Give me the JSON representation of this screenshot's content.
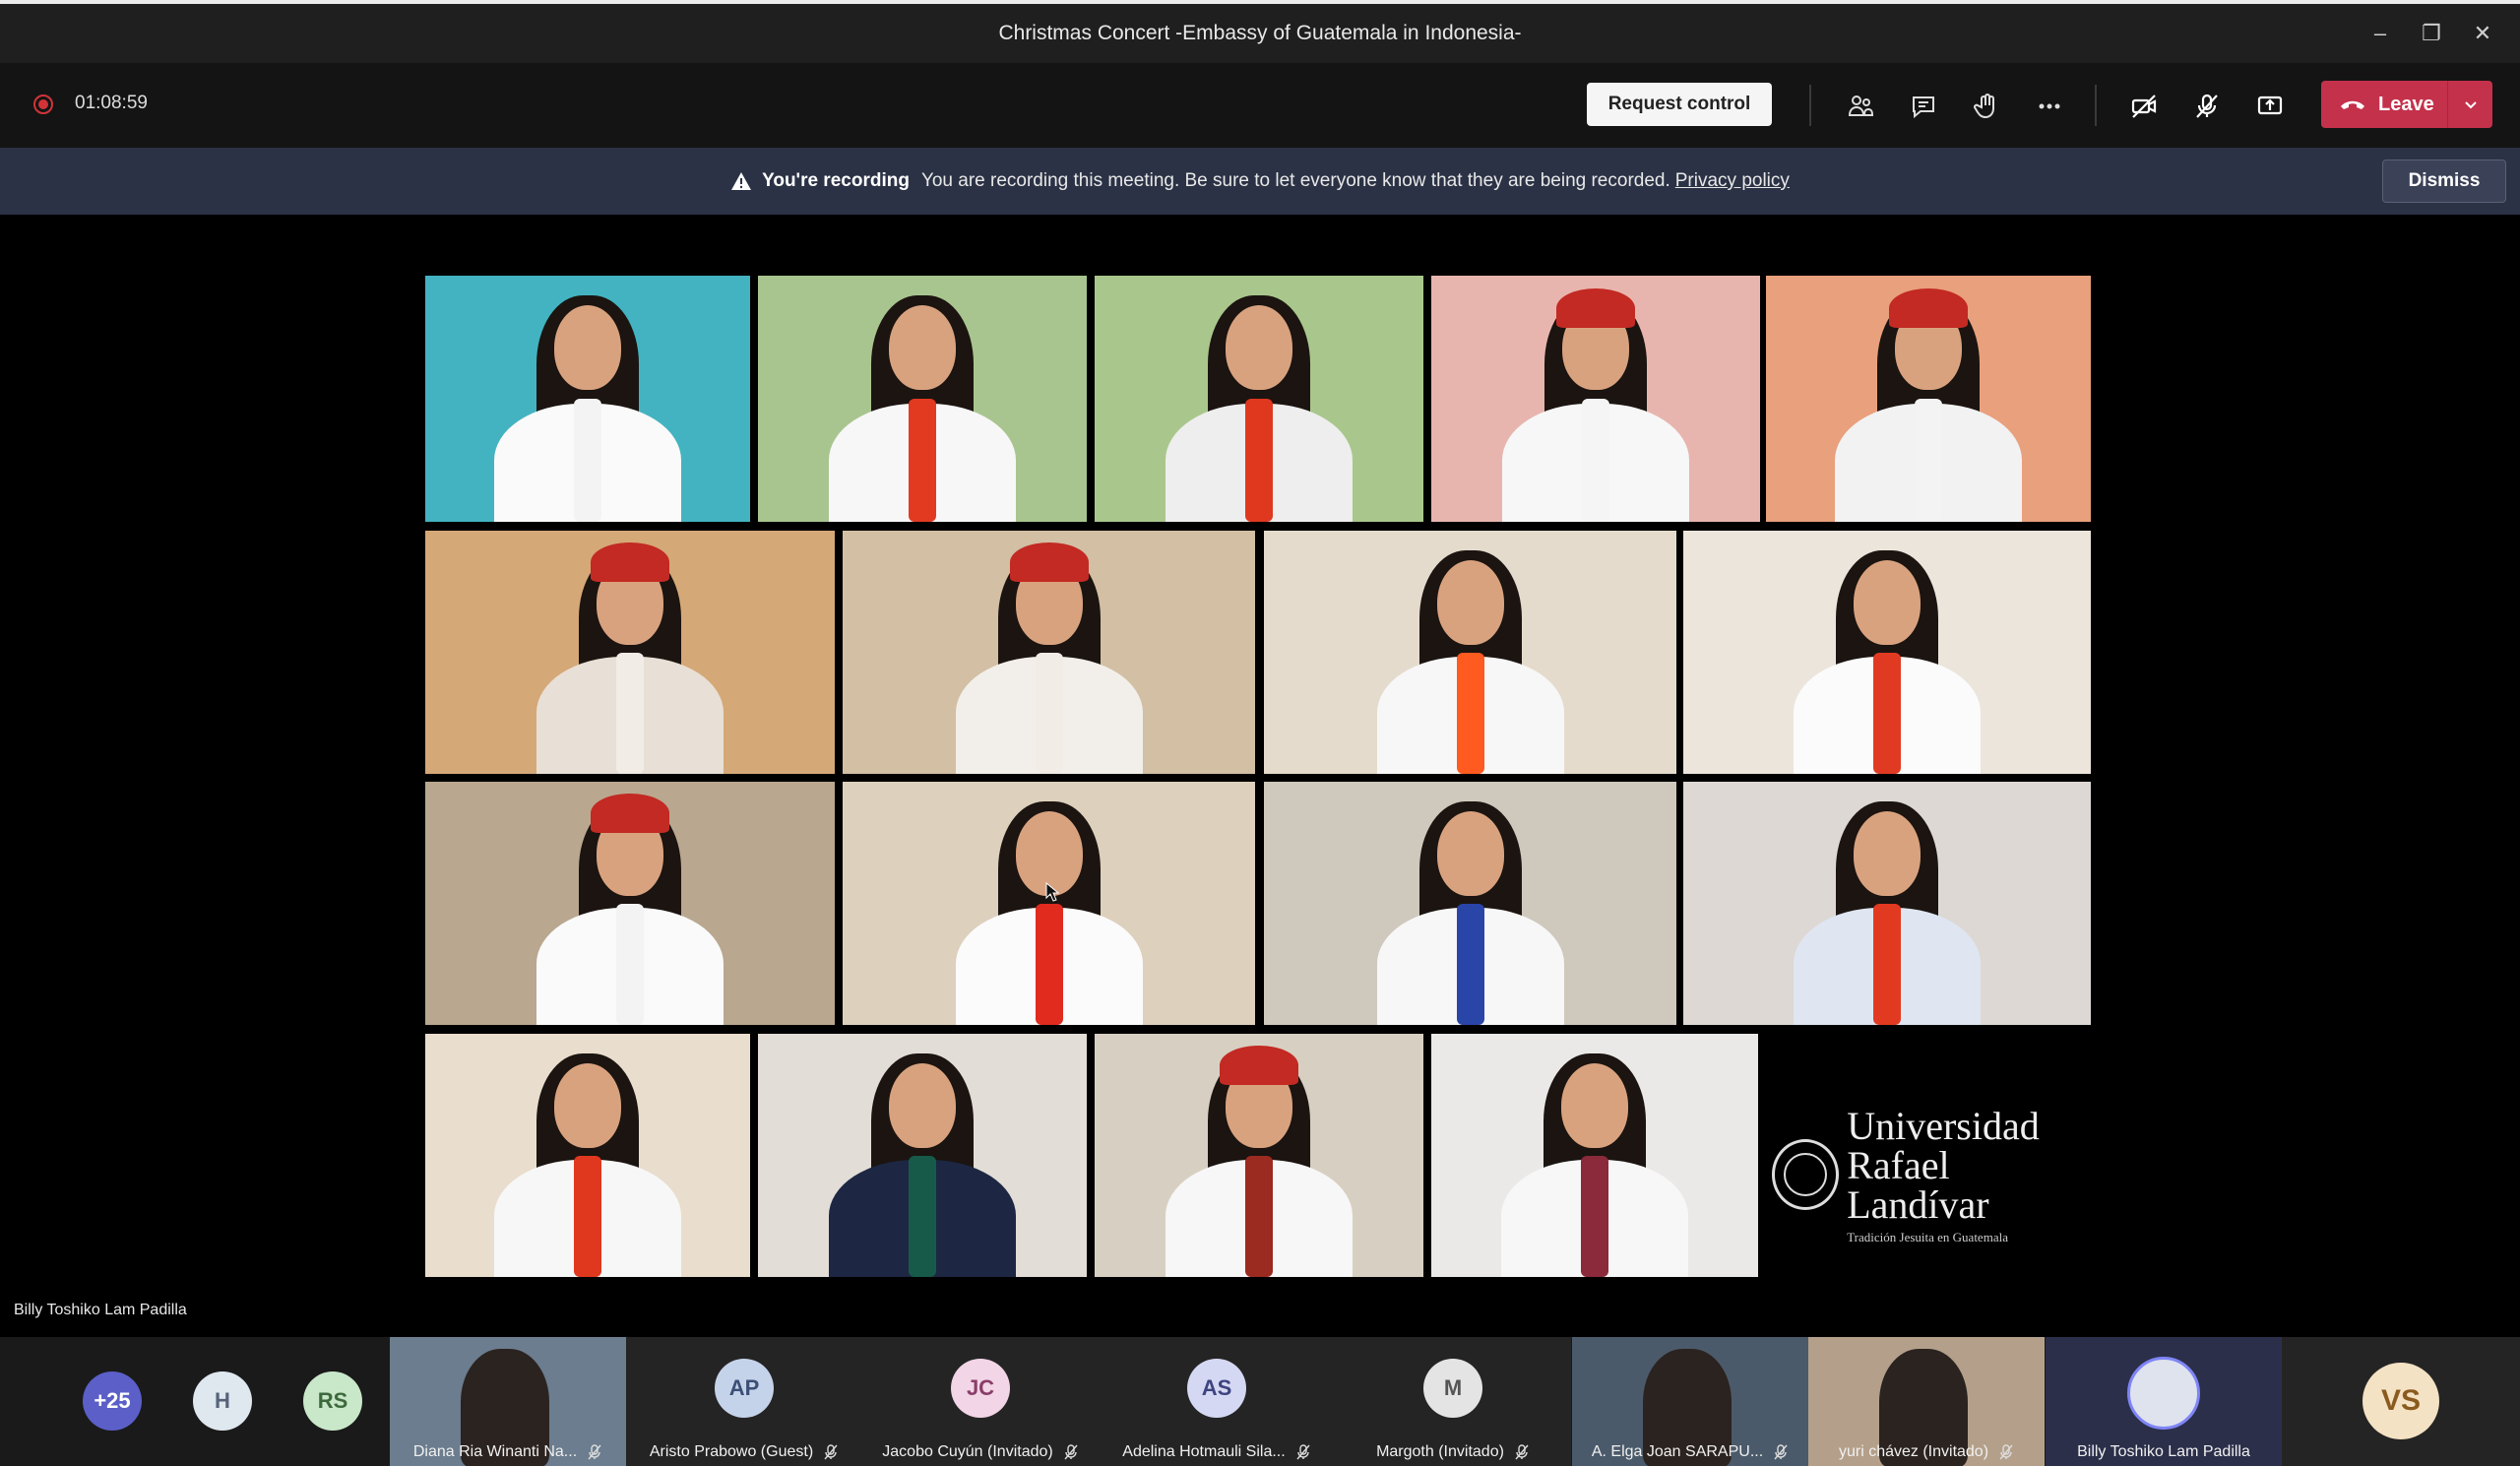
{
  "window": {
    "title": "Christmas Concert -Embassy of Guatemala in Indonesia-"
  },
  "toolbar": {
    "timer": "01:08:59",
    "request_control_label": "Request control",
    "leave_label": "Leave",
    "colors": {
      "leave": "#c4314b",
      "recording": "#d13438"
    }
  },
  "banner": {
    "strong": "You're recording",
    "message": "You are recording this meeting. Be sure to let everyone know that they are being recorded.",
    "link": "Privacy policy",
    "dismiss_label": "Dismiss"
  },
  "stage": {
    "presenter_name": "Billy Toshiko Lam Padilla",
    "logo": {
      "line1": "Universidad",
      "line2": "Rafael Landívar",
      "tagline": "Tradición Jesuita en Guatemala"
    }
  },
  "gallery": {
    "overflow_count": "+25",
    "avatars": [
      {
        "initials": "H",
        "color": "#dfe7ef",
        "text": "#55637a"
      },
      {
        "initials": "RS",
        "color": "#c9e7c9",
        "text": "#3d6a3d"
      }
    ],
    "tiles": [
      {
        "name": "Diana Ria Winanti Na...",
        "type": "video",
        "muted": true
      },
      {
        "name": "Aristo Prabowo (Guest)",
        "initials": "AP",
        "color": "#c5d3ea",
        "text": "#3c4f76",
        "muted": true
      },
      {
        "name": "Jacobo Cuyún (Invitado)",
        "initials": "JC",
        "color": "#f2d5e6",
        "text": "#8a3d6a",
        "muted": true
      },
      {
        "name": "Adelina Hotmauli Sila...",
        "initials": "AS",
        "color": "#d5d8f2",
        "text": "#3d4480",
        "muted": true
      },
      {
        "name": "Margoth (Invitado)",
        "initials": "M",
        "color": "#e4e4e4",
        "text": "#555",
        "muted": true
      },
      {
        "name": "A. Elga Joan SARAPU...",
        "type": "video",
        "muted": true
      },
      {
        "name": "yuri chávez (Invitado)",
        "type": "video",
        "muted": true
      },
      {
        "name": "Billy Toshiko Lam Padilla",
        "type": "photo",
        "muted": false
      },
      {
        "name": "",
        "initials": "VS",
        "color": "#f4e2c4",
        "text": "#8a5a1e",
        "muted": false
      }
    ]
  }
}
